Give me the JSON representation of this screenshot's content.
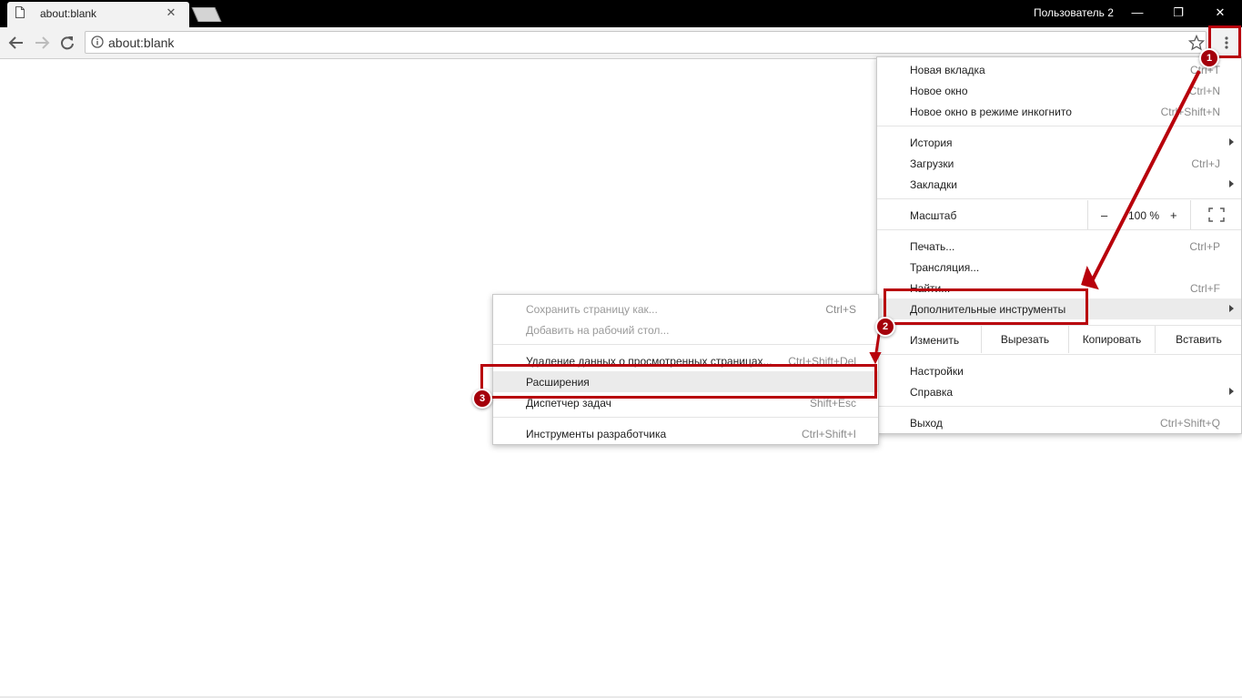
{
  "window": {
    "tab_title": "about:blank",
    "profile_name": "Пользователь 2",
    "minimize_glyph": "—",
    "maximize_glyph": "❐",
    "close_glyph": "✕",
    "tab_close_glyph": "✕"
  },
  "toolbar": {
    "url": "about:blank",
    "icons": [
      "back-icon",
      "forward-icon",
      "reload-icon",
      "info-icon",
      "star-icon",
      "menu-icon"
    ]
  },
  "main_menu": {
    "new_tab": {
      "label": "Новая вкладка",
      "shortcut": "Ctrl+T"
    },
    "new_window": {
      "label": "Новое окно",
      "shortcut": "Ctrl+N"
    },
    "incognito": {
      "label": "Новое окно в режиме инкогнито",
      "shortcut": "Ctrl+Shift+N"
    },
    "history": {
      "label": "История"
    },
    "downloads": {
      "label": "Загрузки",
      "shortcut": "Ctrl+J"
    },
    "bookmarks": {
      "label": "Закладки"
    },
    "zoom": {
      "label": "Масштаб",
      "minus": "–",
      "value": "100 %",
      "plus": "+"
    },
    "print": {
      "label": "Печать...",
      "shortcut": "Ctrl+P"
    },
    "cast": {
      "label": "Трансляция..."
    },
    "find": {
      "label": "Найти...",
      "shortcut": "Ctrl+F"
    },
    "more_tools": {
      "label": "Дополнительные инструменты"
    },
    "edit": {
      "label": "Изменить",
      "cut": "Вырезать",
      "copy": "Копировать",
      "paste": "Вставить"
    },
    "settings": {
      "label": "Настройки"
    },
    "help": {
      "label": "Справка"
    },
    "exit": {
      "label": "Выход",
      "shortcut": "Ctrl+Shift+Q"
    }
  },
  "submenu": {
    "save_page": {
      "label": "Сохранить страницу как...",
      "shortcut": "Ctrl+S"
    },
    "add_desktop": {
      "label": "Добавить на рабочий стол..."
    },
    "clear_data": {
      "label": "Удаление данных о просмотренных страницах...",
      "shortcut": "Ctrl+Shift+Del"
    },
    "extensions": {
      "label": "Расширения"
    },
    "task_manager": {
      "label": "Диспетчер задач",
      "shortcut": "Shift+Esc"
    },
    "dev_tools": {
      "label": "Инструменты разработчика",
      "shortcut": "Ctrl+Shift+I"
    }
  },
  "annotations": {
    "badge_1": "1",
    "badge_2": "2",
    "badge_3": "3",
    "color": "#b8000b"
  }
}
